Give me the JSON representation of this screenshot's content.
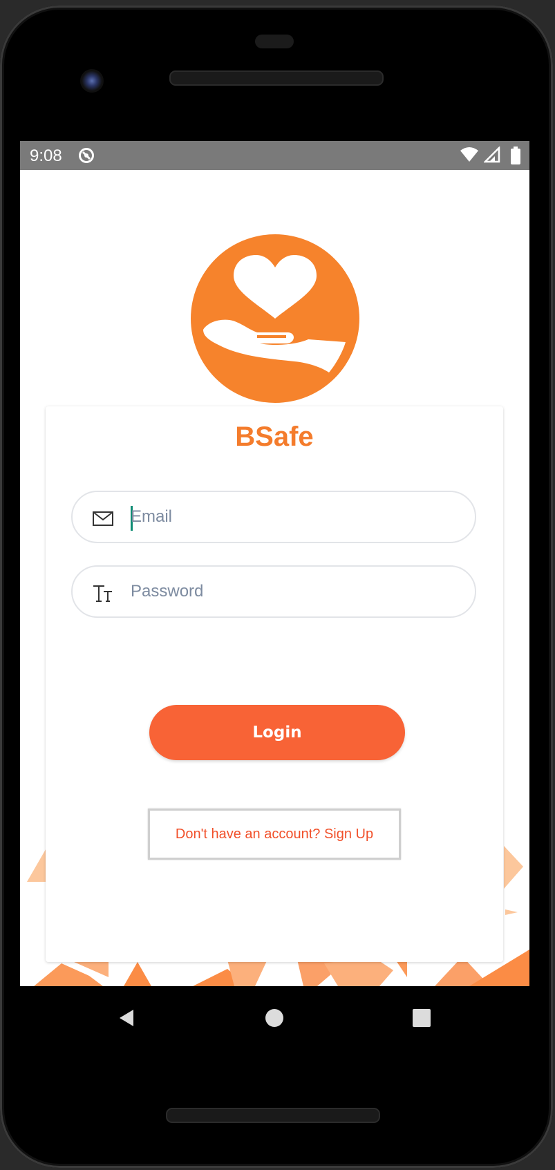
{
  "status_bar": {
    "time": "9:08",
    "icons": [
      "data-saver-icon",
      "wifi-icon",
      "signal-icon",
      "battery-icon"
    ]
  },
  "app": {
    "title": "BSafe",
    "logo_icon": "heart-in-hand-icon"
  },
  "form": {
    "email": {
      "placeholder": "Email",
      "value": "",
      "icon": "envelope-icon"
    },
    "password": {
      "placeholder": "Password",
      "value": "",
      "icon": "text-format-icon"
    }
  },
  "buttons": {
    "login_label": "Login",
    "signup_label": "Don't have an account? Sign Up"
  },
  "nav_bar": {
    "icons": [
      "back-icon",
      "home-icon",
      "recents-icon"
    ]
  },
  "colors": {
    "brand_orange": "#f47c2c",
    "login_button": "#f86336",
    "signup_text": "#f1502a",
    "status_bar": "#7a7a7a"
  }
}
